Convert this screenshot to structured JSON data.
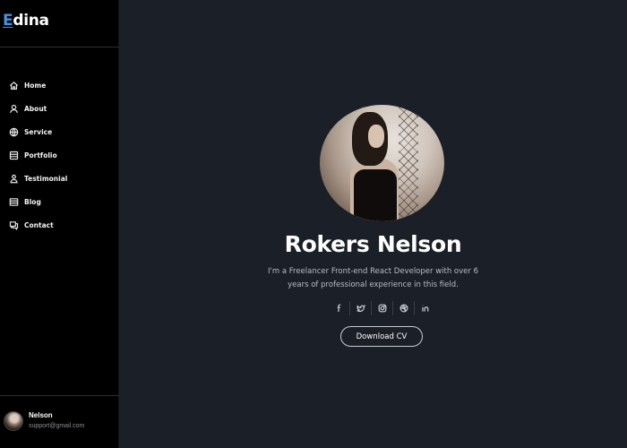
{
  "sidebar": {
    "logo": {
      "first_letter": "E",
      "rest": "dina"
    },
    "items": [
      {
        "label": "Home",
        "icon": "home-icon"
      },
      {
        "label": "About",
        "icon": "user-icon"
      },
      {
        "label": "Service",
        "icon": "globe-icon"
      },
      {
        "label": "Portfolio",
        "icon": "portfolio-icon"
      },
      {
        "label": "Testimonial",
        "icon": "testimonial-icon"
      },
      {
        "label": "Blog",
        "icon": "blog-icon"
      },
      {
        "label": "Contact",
        "icon": "contact-icon"
      }
    ],
    "user": {
      "name": "Nelson",
      "email": "support@gmail.com"
    }
  },
  "hero": {
    "name": "Rokers Nelson",
    "bio_line1": "I'm a Freelancer Front-end React Developer with over 6",
    "bio_line2": "years of professional experience in this field.",
    "socials": [
      "facebook-icon",
      "twitter-icon",
      "instagram-icon",
      "dribbble-icon",
      "linkedin-icon"
    ],
    "cv_button": "Download CV"
  },
  "colors": {
    "sidebar_bg": "#000000",
    "main_bg": "#1b1f27",
    "logo_accent": "#4a8fe0",
    "text": "#ffffff",
    "muted_text": "#b9bcc3"
  }
}
